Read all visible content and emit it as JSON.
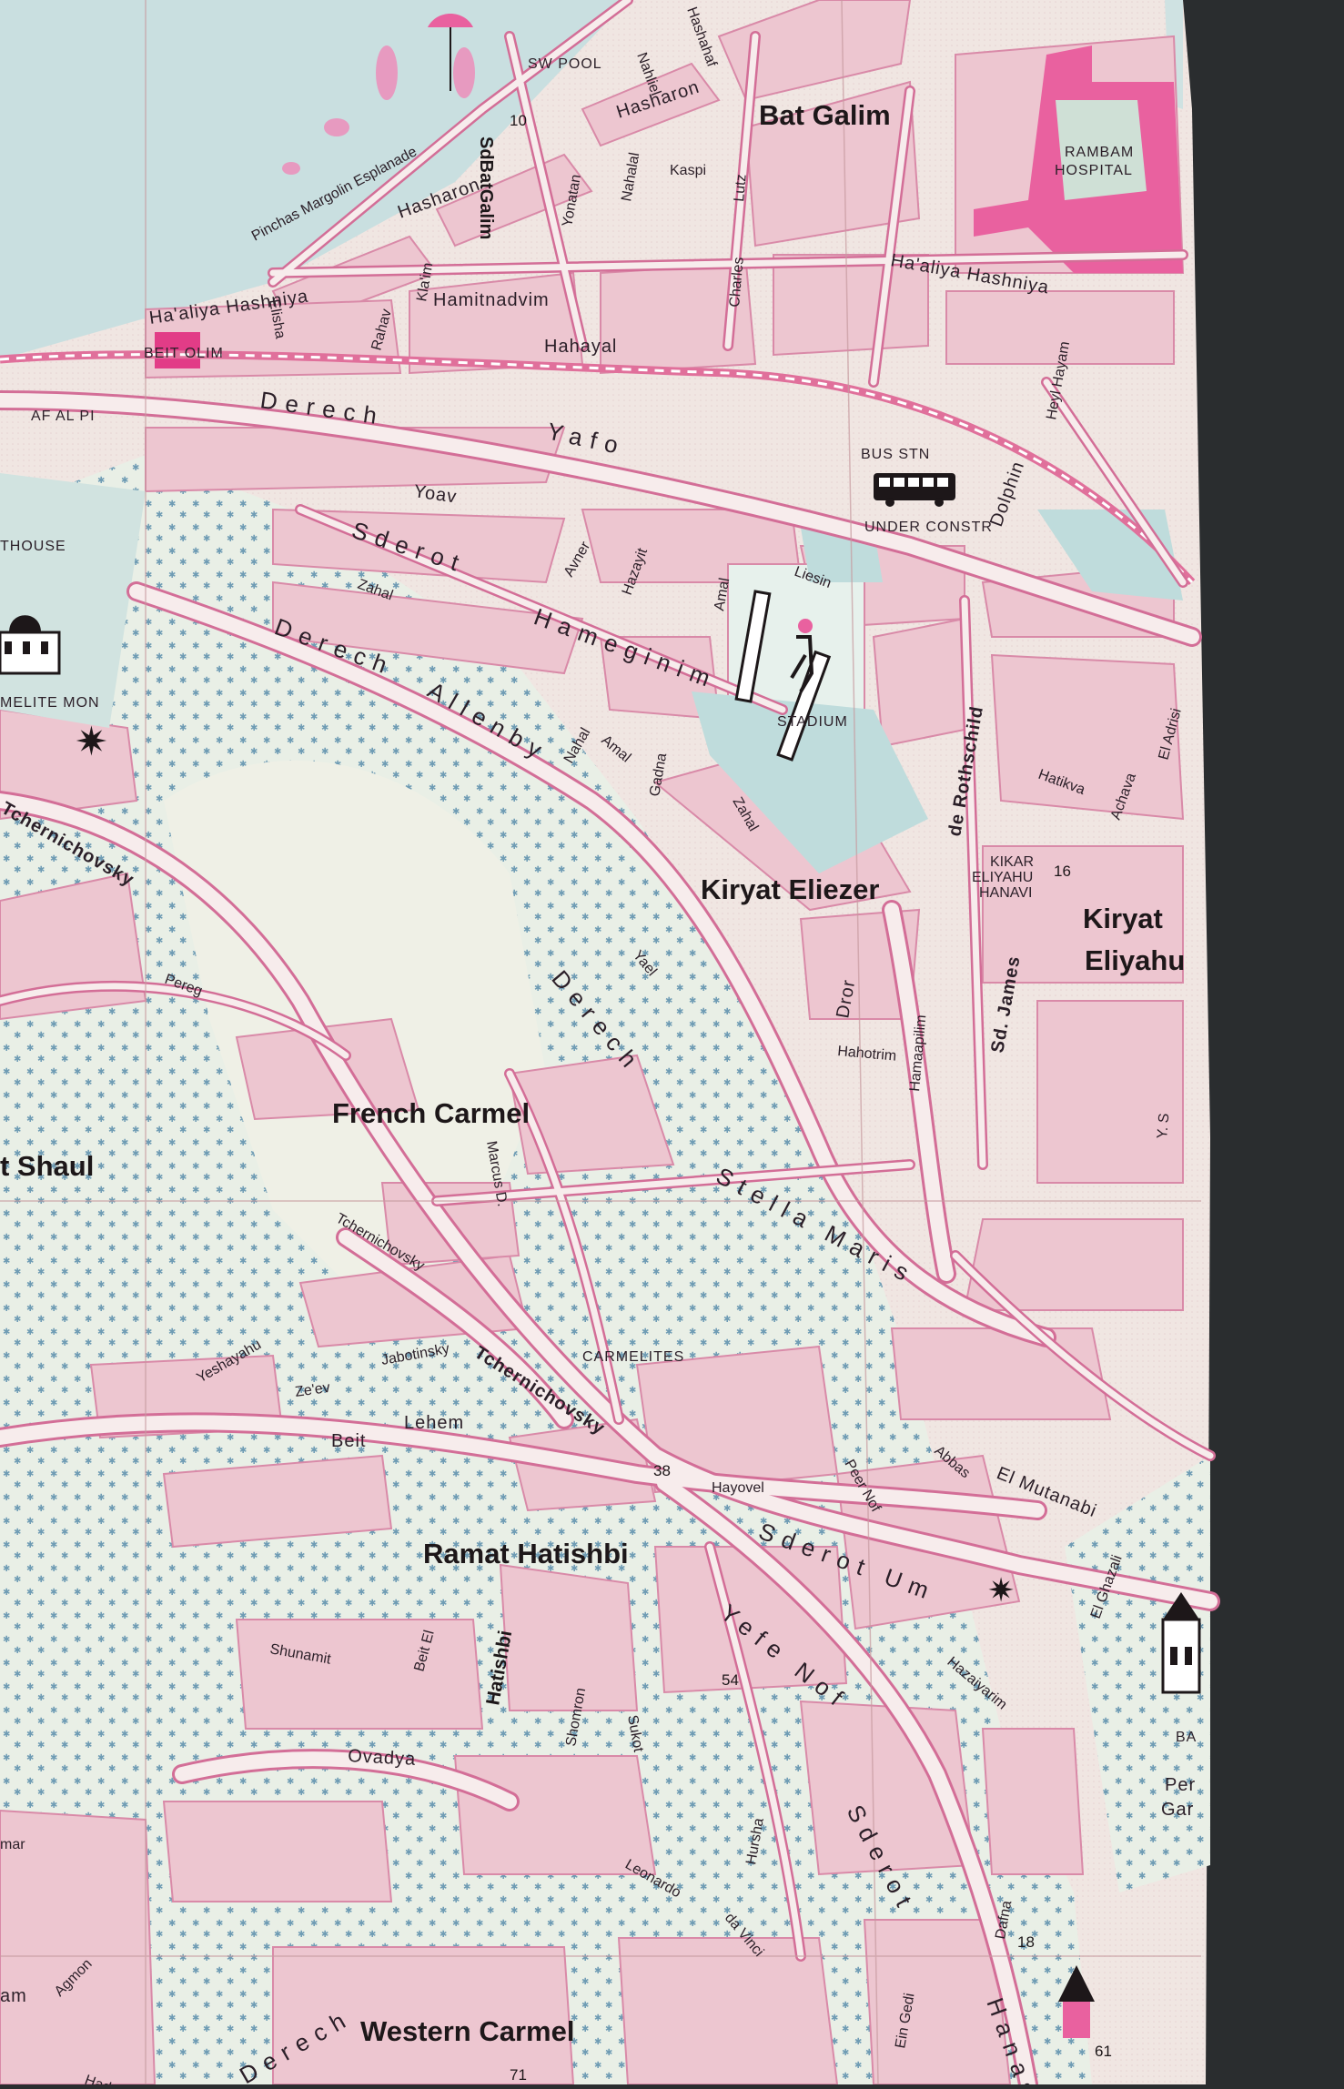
{
  "map": {
    "districts": [
      "Bat Galim",
      "Kiryat Eliezer",
      "Kiryat",
      "Eliyahu",
      "French Carmel",
      "t Shaul",
      "Ramat Hatishbi",
      "Western Carmel"
    ],
    "landmarks": [
      "SW POOL",
      "RAMBAM",
      "HOSPITAL",
      "BEIT OLIM",
      "AF AL PI",
      "BUS STN",
      "UNDER CONSTR",
      "THOUSE",
      "MELITE MON",
      "STADIUM",
      "KIKAR",
      "ELIYAHU",
      "HANAVI",
      "CARMELITES",
      "BA",
      "Per",
      "Gar"
    ],
    "streets": {
      "pinchas": "Pinchas Margolin Esplanade",
      "hasharon1": "Hasharon",
      "hasharon2": "Hasharon",
      "sdbatgalim": "SdBatGalim",
      "yonatan": "Yonatan",
      "nahalal": "Nahalal",
      "kaspi": "Kaspi",
      "lutz": "Lutz",
      "charles": "Charles",
      "nahliel": "Nahliel",
      "hashahaf": "Hashahaf",
      "haaliya1": "Ha'aliya Hashniya",
      "haaliya2": "Ha'aliya Hashniya",
      "elisha": "Elisha",
      "rahav": "Rahav",
      "klaim": "Kla'im",
      "hamitnadvim": "Hamitnadvim",
      "hahayal": "Hahayal",
      "derech": "Derech",
      "yafo": "Yafo",
      "yoav": "Yoav",
      "avner": "Avner",
      "hazayit": "Hazayit",
      "amal1": "Amal",
      "liesin": "Liesin",
      "dolphin": "Dolphin",
      "heylhayam": "Heyl Hayam",
      "sderot1": "Sderot",
      "hameginim": "Hameginim",
      "zahal1": "Zahal",
      "derech2": "Derech",
      "allenby": "Allenby",
      "nahal": "Nahal",
      "amal2": "Amal",
      "gadna": "Gadna",
      "zahal2": "Zahal",
      "rothschild": "de Rothschild",
      "hatikva": "Hatikva",
      "achava": "Achava",
      "eladrisi": "El Adrisi",
      "sdjames": "Sd. James",
      "tchernichovsky1": "Tchernichovsky",
      "tchernichovsky2": "Tchernichovsky",
      "tchernichovsky3": "Tchernichovsky",
      "pereg": "Pereg",
      "derech3": "Derech",
      "stellamaris": "Stella Maris",
      "yael": "Yael",
      "dror": "Dror",
      "hahotrim": "Hahotrim",
      "hamaapilim": "Hamaapilim",
      "marcus": "Marcus D.",
      "jabotinsky": "Jabotinsky",
      "yeshayahu": "Yeshayahu",
      "zeev": "Ze'ev",
      "beit": "Beit",
      "lehem": "Lehem",
      "hayovel": "Hayovel",
      "peernof": "Peer Nof",
      "abbas": "Abbas",
      "elmutanabi": "El Mutanabi",
      "elghazali": "El Ghazali",
      "sderotum": "Sderot Um",
      "yefenof": "Yefe Nof",
      "hazaiyarim": "Hazaiyarim",
      "hatishbi": "Hatishbi",
      "shunamit": "Shunamit",
      "beitel": "Beit El",
      "shomron": "Shomron",
      "sukot": "Sukot",
      "ovadya": "Ovadya",
      "hursha": "Hursha",
      "leonardo": "Leonardo",
      "davinci": "da Vinci",
      "sderot3": "Sderot",
      "dafna": "Dafna",
      "ein": "Ein Gedi",
      "hanas": "Hanas",
      "agmon": "Agmon",
      "hadar": "Hador",
      "derech4": "Derech",
      "mar": "mar",
      "am": "am",
      "ys": "Y. S"
    },
    "numbers": [
      "10",
      "16",
      "38",
      "54",
      "18",
      "61",
      "71"
    ],
    "colors": {
      "sea": "#c9dfe0",
      "land": "#f1e9e2",
      "block": "#edc6d0",
      "road": "#f7ecec",
      "road_edge": "#d36e97",
      "park": "#e6eee4",
      "hospital": "#e9619f",
      "backing": "#2a2d2f"
    }
  }
}
